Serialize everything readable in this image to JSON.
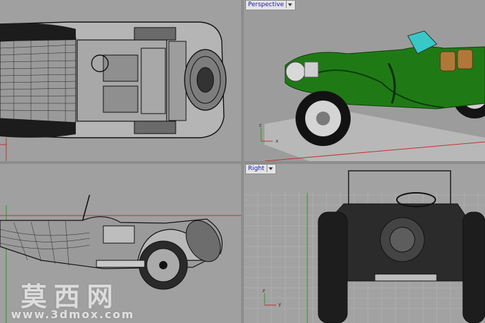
{
  "viewports": {
    "top": {
      "label": ""
    },
    "perspective": {
      "label": "Perspective"
    },
    "front": {
      "label": ""
    },
    "right": {
      "label": "Right"
    }
  },
  "axes": {
    "x": "x",
    "y": "y",
    "z": "z"
  },
  "watermark": {
    "text_cn": "莫西网",
    "url": "www.3dmox.com"
  },
  "colors": {
    "car_body": "#1f7a16",
    "grid_red": "#c43030",
    "grid_green": "#2a9a2a",
    "label_text": "#1a1aa8"
  }
}
